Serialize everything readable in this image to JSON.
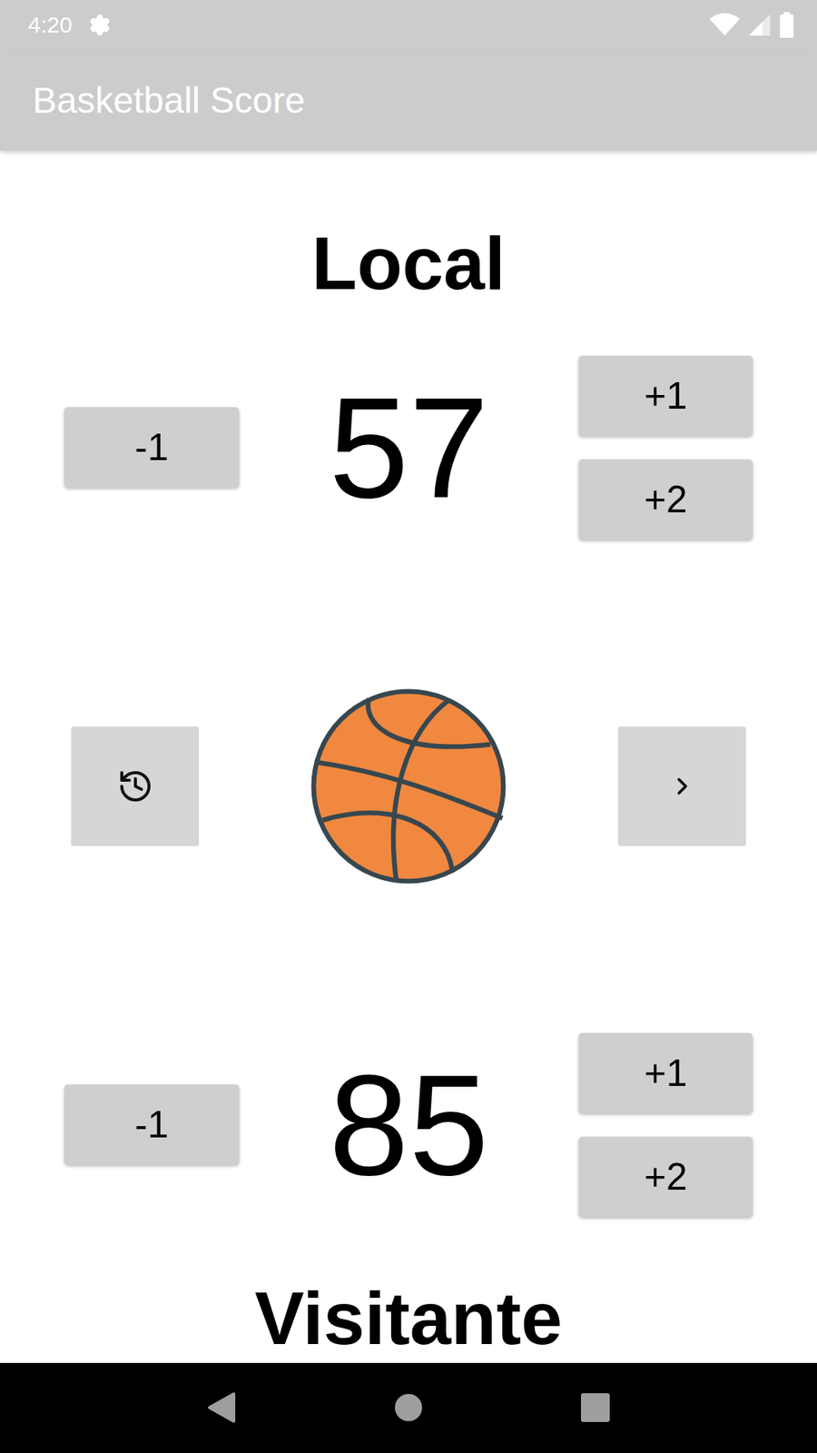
{
  "status_bar": {
    "time": "4:20"
  },
  "app_bar": {
    "title": "Basketball Score"
  },
  "teams": [
    {
      "name": "Local",
      "score": "57",
      "decrement": "-1",
      "increments": [
        "+1",
        "+2"
      ]
    },
    {
      "name": "Visitante",
      "score": "85",
      "decrement": "-1",
      "increments": [
        "+1",
        "+2"
      ]
    }
  ]
}
